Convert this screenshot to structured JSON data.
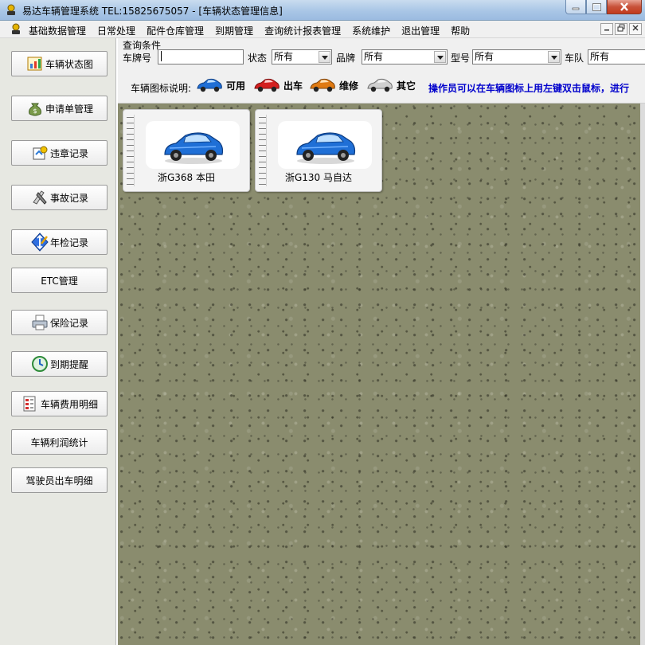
{
  "window": {
    "title": "易达车辆管理系统  TEL:15825675057 - [车辆状态管理信息]"
  },
  "menu": {
    "items": [
      "基础数据管理",
      "日常处理",
      "配件仓库管理",
      "到期管理",
      "查询统计报表管理",
      "系统维护",
      "退出管理",
      "帮助"
    ]
  },
  "sidebar": {
    "items": [
      {
        "label": "车辆状态图",
        "icon": "status-chart-icon"
      },
      {
        "label": "申请单管理",
        "icon": "money-bag-icon"
      },
      {
        "label": "违章记录",
        "icon": "violation-icon"
      },
      {
        "label": "事故记录",
        "icon": "accident-icon"
      },
      {
        "label": "年检记录",
        "icon": "inspection-icon"
      },
      {
        "label": "ETC管理",
        "icon": ""
      },
      {
        "label": "保险记录",
        "icon": "printer-icon"
      },
      {
        "label": "到期提醒",
        "icon": "clock-icon"
      },
      {
        "label": "车辆费用明细",
        "icon": "cost-list-icon"
      },
      {
        "label": "车辆利润统计",
        "icon": ""
      },
      {
        "label": "驾驶员出车明细",
        "icon": ""
      }
    ]
  },
  "query": {
    "caption": "查询条件",
    "plate_label": "车牌号",
    "plate_value": "",
    "status_label": "状态",
    "status_value": "所有",
    "brand_label": "品牌",
    "brand_value": "所有",
    "model_label": "型号",
    "model_value": "所有",
    "team_label": "车队",
    "team_value": "所有"
  },
  "legend": {
    "label": "车辆图标说明:",
    "items": [
      {
        "text": "可用",
        "color": "#1f6fd6"
      },
      {
        "text": "出车",
        "color": "#d41f1f"
      },
      {
        "text": "维修",
        "color": "#e07a12"
      },
      {
        "text": "其它",
        "color": "#bdbdbd"
      }
    ],
    "notice": "操作员可以在车辆图标上用左键双击鼠标，进行"
  },
  "vehicles": [
    {
      "plate": "浙G368 本田",
      "status_color": "#1f6fd6"
    },
    {
      "plate": "浙G130 马自达",
      "status_color": "#1f6fd6"
    }
  ]
}
